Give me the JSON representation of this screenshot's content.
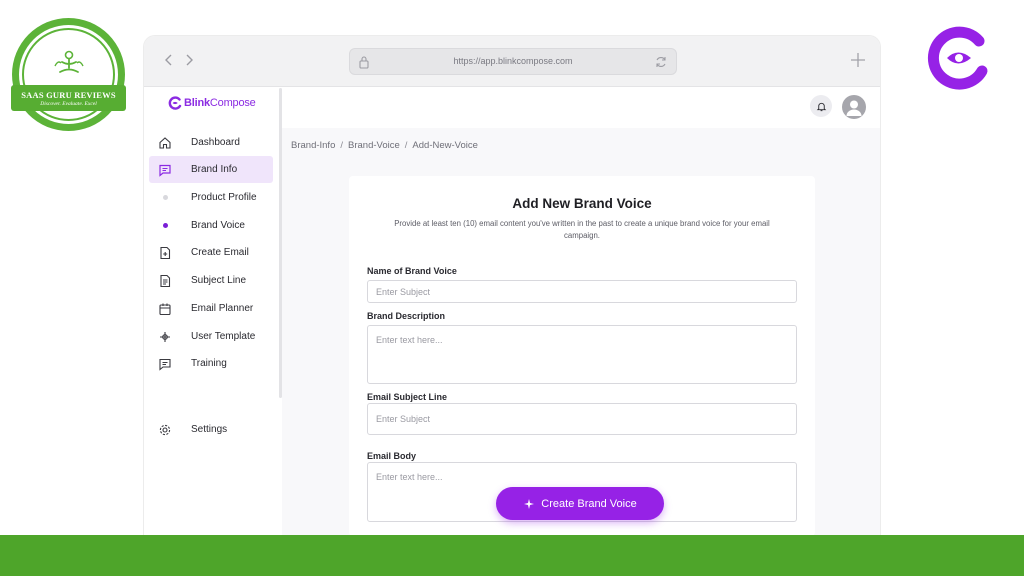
{
  "overlay": {
    "badge_title": "SAAS GURU REVIEWS",
    "badge_subtitle": "Discover. Evaluate. Excel"
  },
  "browser": {
    "url": "https://app.blinkcompose.com"
  },
  "app": {
    "logo_bold": "Blink",
    "logo_light": "Compose"
  },
  "sidebar": {
    "items": [
      {
        "label": "Dashboard",
        "icon": "home-icon"
      },
      {
        "label": "Brand Info",
        "icon": "message-square-icon",
        "active": true
      },
      {
        "label": "Product Profile",
        "icon": "dot-icon"
      },
      {
        "label": "Brand Voice",
        "icon": "dot-icon"
      },
      {
        "label": "Create Email",
        "icon": "file-plus-icon"
      },
      {
        "label": "Subject Line",
        "icon": "file-text-icon"
      },
      {
        "label": "Email Planner",
        "icon": "calendar-icon"
      },
      {
        "label": "User Template",
        "icon": "template-icon"
      },
      {
        "label": "Training",
        "icon": "message-icon"
      }
    ],
    "settings_label": "Settings"
  },
  "breadcrumb": [
    "Brand-Info",
    "Brand-Voice",
    "Add-New-Voice"
  ],
  "form": {
    "title": "Add New Brand Voice",
    "description": "Provide at least ten (10) email content you've written in the past to create a unique brand voice for your email campaign.",
    "name_label": "Name of Brand Voice",
    "name_placeholder": "Enter Subject",
    "desc_label": "Brand Description",
    "desc_placeholder": "Enter text here...",
    "subject_label": "Email Subject Line",
    "subject_placeholder": "Enter Subject",
    "body_label": "Email Body",
    "body_placeholder": "Enter text here...",
    "submit_label": "Create Brand Voice"
  },
  "colors": {
    "brand": "#9622e6",
    "active_bg": "#f0e5fb",
    "green": "#4ea52a"
  }
}
